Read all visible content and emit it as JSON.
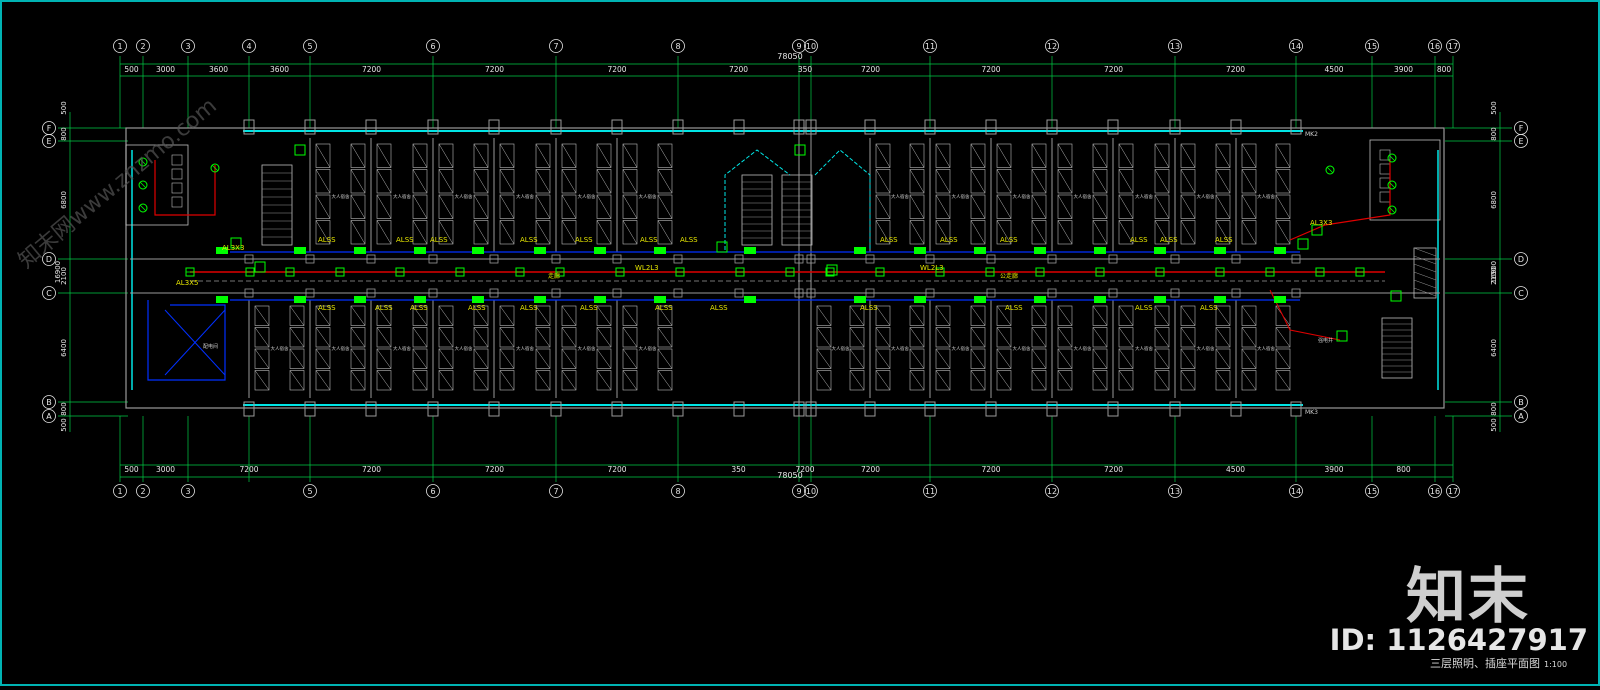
{
  "grid_top": [
    "1",
    "2",
    "3",
    "4",
    "5",
    "6",
    "7",
    "8",
    "9",
    "10",
    "11",
    "12",
    "13",
    "14",
    "15",
    "16",
    "17"
  ],
  "grid_bottom": [
    "1",
    "2",
    "3",
    "5",
    "6",
    "7",
    "8",
    "9",
    "10",
    "11",
    "12",
    "13",
    "14",
    "15",
    "16",
    "17"
  ],
  "dims_top": [
    "500",
    "3000",
    "3600",
    "3600",
    "7200",
    "7200",
    "7200",
    "7200",
    "350",
    "7200",
    "7200",
    "7200",
    "7200",
    "4500",
    "3900",
    "800"
  ],
  "dims_bottom": [
    "500",
    "3000",
    "7200",
    "7200",
    "7200",
    "7200",
    "350",
    "7200",
    "7200",
    "7200",
    "7200",
    "4500",
    "3900",
    "800"
  ],
  "total_dim": "78050",
  "rows_left": [
    "F",
    "E",
    "D",
    "C",
    "B",
    "A"
  ],
  "rows_right": [
    "F",
    "E",
    "D",
    "C",
    "B",
    "A"
  ],
  "side_dims": [
    "500",
    "800",
    "6800",
    "2100",
    "16900",
    "6400",
    "800",
    "500"
  ],
  "room_label": "大人宿舍",
  "circuit_label": "ALSS",
  "panel_labels": {
    "left_top": "AL3X3",
    "left_mid": "AL3X5",
    "right_top": "AL3X3",
    "mid_left": "WL2L3",
    "mid_right": "WL2L3"
  },
  "corridor_labels": [
    "走廊",
    "公走廊"
  ],
  "box_labels": {
    "left_room": "配电间",
    "right_room": "强电井"
  },
  "mk_labels": {
    "top": "MK2",
    "bottom": "MK3"
  },
  "title": {
    "text": "三层照明、插座平面图",
    "scale": "1:100"
  },
  "watermarks": {
    "logo": "知末",
    "id": "ID: 1126427917",
    "diagonal": "知末网www.znzmo.com"
  },
  "colors": {
    "background": "#000000",
    "grid": "#00cc44",
    "wall": "#9a9a9a",
    "window": "#00e5e5",
    "bus": "#e00000",
    "corridor": "#0030ff",
    "fixture": "#00ff00",
    "label": "#e6e600"
  }
}
